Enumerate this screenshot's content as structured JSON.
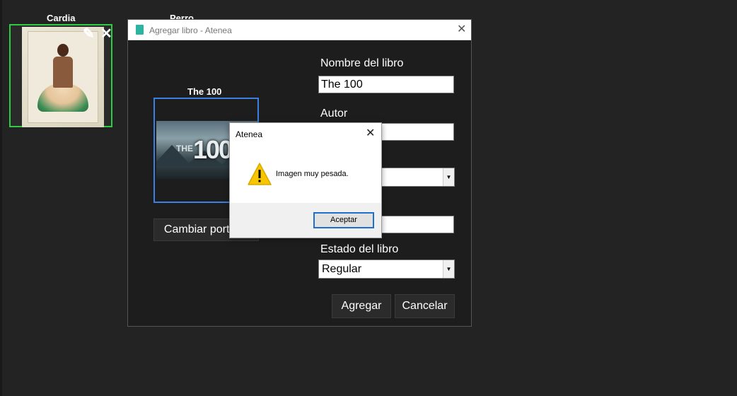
{
  "library": {
    "books": [
      {
        "title": "Cardia"
      },
      {
        "title": "Perro"
      }
    ],
    "edit_icon": "pencil-icon",
    "delete_icon": "close-icon"
  },
  "dialog": {
    "title": "Agregar libro - Atenea",
    "cover_title": "The 100",
    "cover_logo": "100",
    "cover_logo_prefix": "THE",
    "change_cover_label": "Cambiar portada",
    "fields": {
      "name_label": "Nombre del libro",
      "name_value": "The 100",
      "author_label": "Autor",
      "author_value": "",
      "combo1_value": "",
      "field4_value": "",
      "state_label": "Estado del libro",
      "state_value": "Regular"
    },
    "add_label": "Agregar",
    "cancel_label": "Cancelar"
  },
  "message_box": {
    "title": "Atenea",
    "message": "Imagen muy pesada.",
    "ok_label": "Aceptar",
    "icon": "warning-icon"
  },
  "colors": {
    "background": "#232323",
    "selected_border": "#2ecc40",
    "cover_border": "#3b7fe0",
    "accent_button_border": "#1f6fd1",
    "warning": "#f7c600"
  }
}
